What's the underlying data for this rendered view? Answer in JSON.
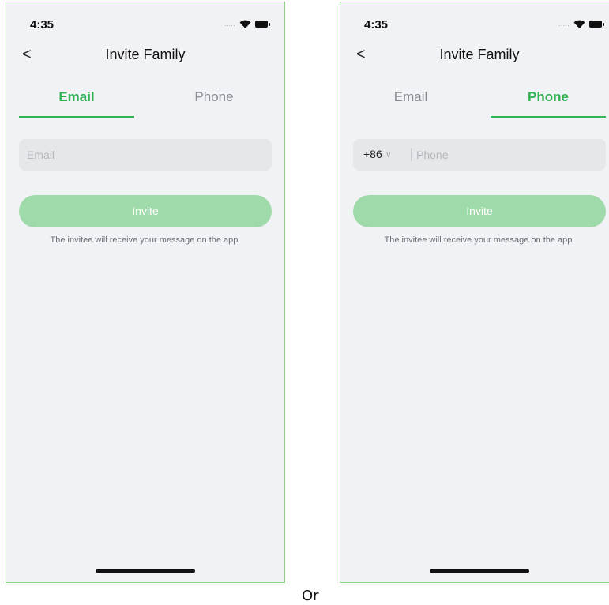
{
  "left_screen": {
    "status": {
      "time": "4:35",
      "signal": "....."
    },
    "nav": {
      "back": "<",
      "title": "Invite Family"
    },
    "tabs": [
      {
        "label": "Email",
        "active": true
      },
      {
        "label": "Phone",
        "active": false
      }
    ],
    "email_field": {
      "placeholder": "Email",
      "value": ""
    },
    "invite_button": "Invite",
    "hint": "The invitee will receive your message on the app."
  },
  "right_screen": {
    "status": {
      "time": "4:35",
      "signal": "....."
    },
    "nav": {
      "back": "<",
      "title": "Invite Family"
    },
    "tabs": [
      {
        "label": "Email",
        "active": false
      },
      {
        "label": "Phone",
        "active": true
      }
    ],
    "phone_field": {
      "country_code": "+86",
      "placeholder": "Phone",
      "value": ""
    },
    "invite_button": "Invite",
    "hint": "The invitee will receive your message on the app."
  },
  "separator_text": "Or",
  "colors": {
    "accent": "#33b354",
    "button_disabled": "#9fdaaa",
    "screen_background": "#f1f2f6",
    "frame_border": "#8fcf86"
  }
}
